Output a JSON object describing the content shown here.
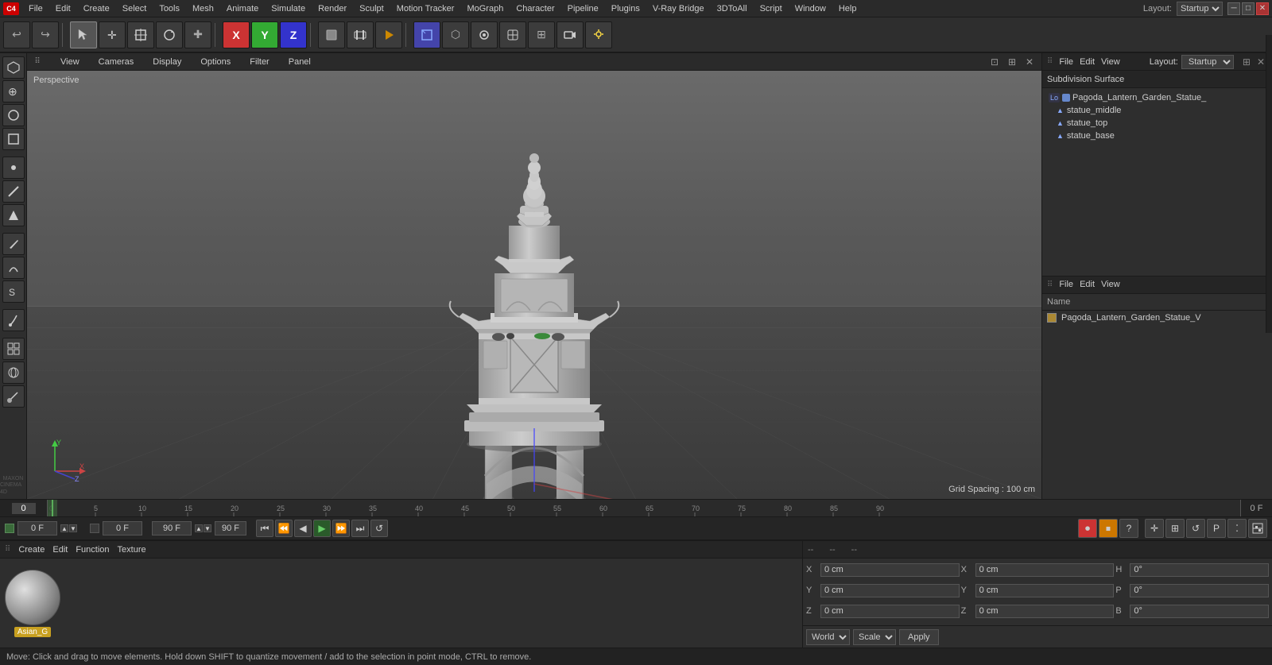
{
  "app": {
    "title": "Cinema 4D"
  },
  "menu_bar": {
    "items": [
      "File",
      "Edit",
      "Create",
      "Select",
      "Tools",
      "Mesh",
      "Animate",
      "Simulate",
      "Render",
      "Sculpt",
      "Motion Tracker",
      "MoGraph",
      "Character",
      "Pipeline",
      "Plugins",
      "V-Ray Bridge",
      "3DToAll",
      "Script",
      "Window",
      "Help"
    ]
  },
  "toolbar": {
    "layout_label": "Layout:",
    "layout_value": "Startup",
    "axis_labels": [
      "X",
      "Y",
      "Z"
    ]
  },
  "viewport": {
    "perspective_label": "Perspective",
    "grid_spacing": "Grid Spacing : 100 cm",
    "menus": [
      "View",
      "Cameras",
      "Display",
      "Options",
      "Filter",
      "Panel"
    ]
  },
  "right_panel_top": {
    "menus": [
      "File",
      "Edit",
      "View"
    ],
    "layout_label": "Layout:",
    "layout_value": "Startup",
    "subdiv_label": "Subdivision Surface",
    "tree_items": [
      {
        "label": "Pagoda_Lantern_Garden_Statue_",
        "level": 0,
        "type": "object",
        "icon": "Lo"
      },
      {
        "label": "statue_middle",
        "level": 1,
        "type": "sub",
        "icon": "▲"
      },
      {
        "label": "statue_top",
        "level": 1,
        "type": "sub",
        "icon": "▲"
      },
      {
        "label": "statue_base",
        "level": 1,
        "type": "sub",
        "icon": "▲"
      }
    ]
  },
  "right_panel_bottom": {
    "menus": [
      "File",
      "Edit",
      "View"
    ],
    "name_label": "Name",
    "object_name": "Pagoda_Lantern_Garden_Statue_V"
  },
  "timeline": {
    "start_frame": "0",
    "markers": [
      "0",
      "5",
      "10",
      "15",
      "20",
      "25",
      "30",
      "35",
      "40",
      "45",
      "50",
      "55",
      "60",
      "65",
      "70",
      "75",
      "80",
      "85",
      "90"
    ],
    "end_frame": "0 F"
  },
  "playback": {
    "current_frame": "0 F",
    "frame_input": "0 F",
    "end_frame": "90 F",
    "end_frame2": "90 F"
  },
  "material_panel": {
    "menus": [
      "Create",
      "Edit",
      "Function",
      "Texture"
    ],
    "material_name": "Asian_G"
  },
  "coord_panel": {
    "header": [
      "--",
      "--",
      "--"
    ],
    "x_pos": "0 cm",
    "x_size": "0 cm",
    "h_rot": "0°",
    "y_pos": "0 cm",
    "y_size": "0 cm",
    "p_rot": "0°",
    "z_pos": "0 cm",
    "z_size": "0 cm",
    "b_rot": "0°",
    "world_label": "World",
    "scale_label": "Scale",
    "apply_label": "Apply"
  },
  "status_bar": {
    "text": "Move: Click and drag to move elements. Hold down SHIFT to quantize movement / add to the selection in point mode, CTRL to remove."
  }
}
